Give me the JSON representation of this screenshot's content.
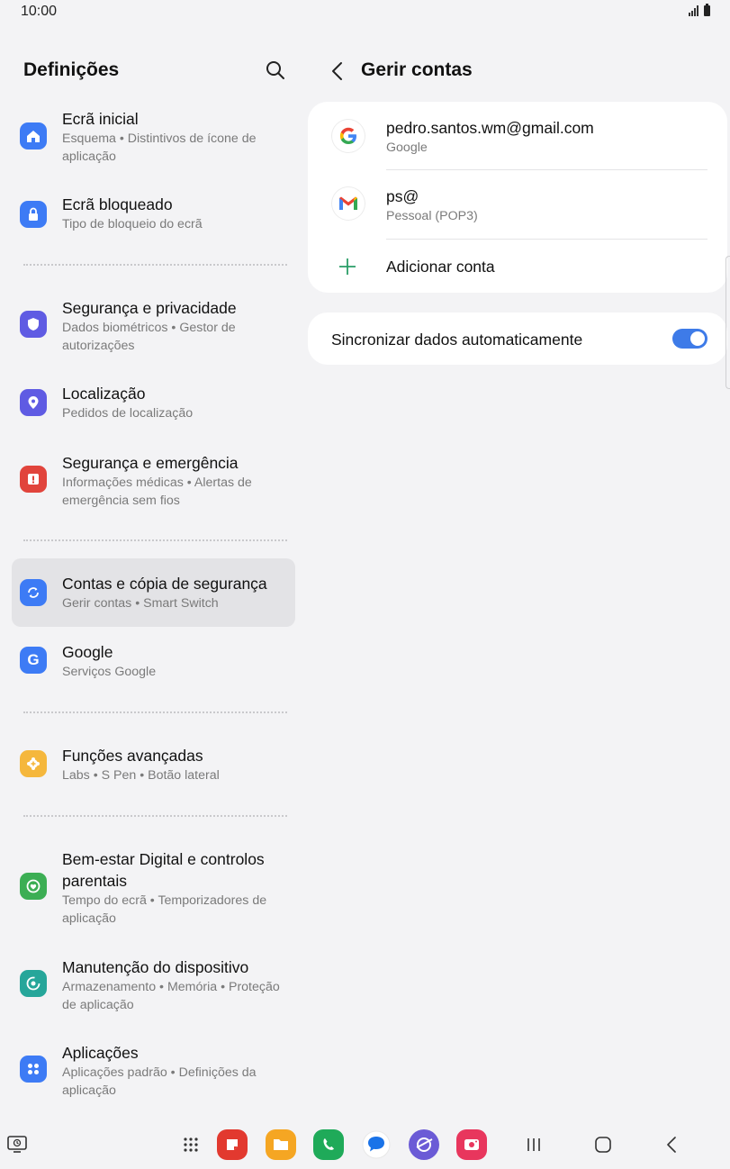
{
  "status_bar": {
    "time": "10:00"
  },
  "left_pane": {
    "title": "Definições",
    "items": [
      {
        "title": "Ecrã inicial",
        "subtitle": "Esquema  •  Distintivos de ícone de aplicação",
        "icon": "home-icon",
        "color": "#3d7bf5"
      },
      {
        "title": "Ecrã bloqueado",
        "subtitle": "Tipo de bloqueio do ecrã",
        "icon": "lock-icon",
        "color": "#3d7bf5"
      },
      {
        "title": "Segurança e privacidade",
        "subtitle": "Dados biométricos  •  Gestor de autorizações",
        "icon": "shield-icon",
        "color": "#5f5be3"
      },
      {
        "title": "Localização",
        "subtitle": "Pedidos de localização",
        "icon": "location-pin-icon",
        "color": "#5f5be3"
      },
      {
        "title": "Segurança e emergência",
        "subtitle": "Informações médicas  •  Alertas de emergência sem fios",
        "icon": "emergency-icon",
        "color": "#e1443c"
      },
      {
        "title": "Contas e cópia de segurança",
        "subtitle": "Gerir contas  •  Smart Switch",
        "icon": "sync-icon",
        "color": "#3d7bf5"
      },
      {
        "title": "Google",
        "subtitle": "Serviços Google",
        "icon": "google-icon",
        "color": "#3d7bf5"
      },
      {
        "title": "Funções avançadas",
        "subtitle": "Labs  •  S Pen  •  Botão lateral",
        "icon": "gear-plus-icon",
        "color": "#f5b73c"
      },
      {
        "title": "Bem-estar Digital e controlos parentais",
        "subtitle": "Tempo do ecrã  •  Temporizadores de aplicação",
        "icon": "heart-circle-icon",
        "color": "#3cae54"
      },
      {
        "title": "Manutenção do dispositivo",
        "subtitle": "Armazenamento  •  Memória  •  Proteção de aplicação",
        "icon": "maintenance-icon",
        "color": "#26a69a"
      },
      {
        "title": "Aplicações",
        "subtitle": "Aplicações padrão  •  Definições da aplicação",
        "icon": "apps-grid-icon",
        "color": "#3d7bf5"
      }
    ]
  },
  "right_pane": {
    "title": "Gerir contas",
    "accounts": [
      {
        "name": "pedro.santos.wm@gmail.com",
        "type": "Google",
        "icon": "google-logo-icon"
      },
      {
        "name": "ps@",
        "type": "Pessoal (POP3)",
        "icon": "gmail-logo-icon"
      }
    ],
    "add_account_label": "Adicionar conta",
    "sync": {
      "label": "Sincronizar dados automaticamente",
      "enabled": true
    }
  },
  "nav_bar": {
    "apps": [
      "samsung-notes-icon",
      "my-files-icon",
      "phone-icon",
      "messages-icon",
      "internet-icon",
      "screen-recorder-icon"
    ]
  }
}
